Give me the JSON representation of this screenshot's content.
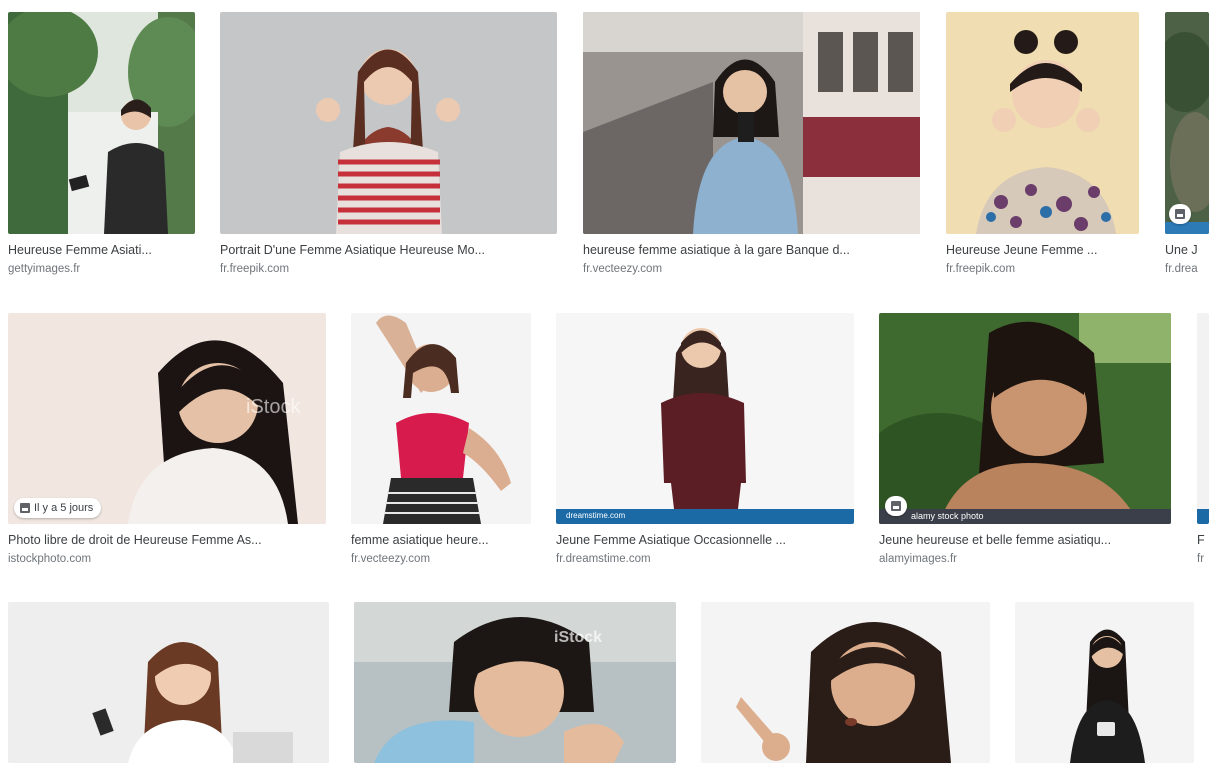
{
  "results": [
    {
      "title": "Heureuse Femme Asiati...",
      "source": "gettyimages.fr"
    },
    {
      "title": "Portrait D'une Femme Asiatique Heureuse Mo...",
      "source": "fr.freepik.com"
    },
    {
      "title": "heureuse femme asiatique à la gare Banque d...",
      "source": "fr.vecteezy.com"
    },
    {
      "title": "Heureuse Jeune Femme ...",
      "source": "fr.freepik.com"
    },
    {
      "title": "Une J",
      "source": "fr.drea"
    },
    {
      "title": "Photo libre de droit de Heureuse Femme As...",
      "source": "istockphoto.com",
      "badge": "Il y a 5 jours"
    },
    {
      "title": "femme asiatique heure...",
      "source": "fr.vecteezy.com"
    },
    {
      "title": "Jeune Femme Asiatique Occasionnelle ...",
      "source": "fr.dreamstime.com",
      "watermark": "dreamstime.com"
    },
    {
      "title": "Jeune heureuse et belle femme asiatiqu...",
      "source": "alamyimages.fr",
      "watermark": "alamy stock photo"
    },
    {
      "title": "F",
      "source": "fr"
    }
  ],
  "watermarks": {
    "istock": "iStock"
  },
  "icons": {
    "image_badge": "image-icon"
  }
}
